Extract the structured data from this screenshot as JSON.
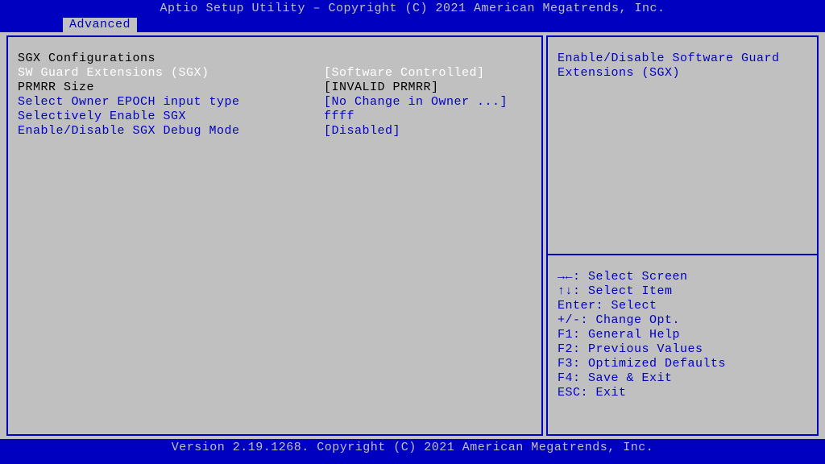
{
  "header": {
    "title": "Aptio Setup Utility – Copyright (C) 2021 American Megatrends, Inc.",
    "active_tab": "Advanced"
  },
  "main": {
    "section_title": "SGX Configurations",
    "rows": [
      {
        "label": "SW Guard Extensions (SGX)",
        "value": "[Software Controlled]",
        "style": "highlight"
      },
      {
        "label": "PRMRR Size",
        "value": "[INVALID PRMRR]",
        "style": "static"
      },
      {
        "label": "Select Owner EPOCH input type",
        "value": "[No Change in Owner ...]",
        "style": "option"
      },
      {
        "label": "Selectively Enable SGX",
        "value": "ffff",
        "style": "option"
      },
      {
        "label": "Enable/Disable SGX Debug Mode",
        "value": "[Disabled]",
        "style": "option"
      }
    ]
  },
  "help": {
    "description_line1": "Enable/Disable Software Guard",
    "description_line2": "Extensions (SGX)",
    "keys": [
      {
        "glyph": "→←",
        "text": ": Select Screen"
      },
      {
        "glyph": "↑↓",
        "text": ": Select Item"
      },
      {
        "glyph": "Enter",
        "text": ": Select"
      },
      {
        "glyph": "+/-",
        "text": ": Change Opt."
      },
      {
        "glyph": "F1",
        "text": ": General Help"
      },
      {
        "glyph": "F2",
        "text": ": Previous Values"
      },
      {
        "glyph": "F3",
        "text": ": Optimized Defaults"
      },
      {
        "glyph": "F4",
        "text": ": Save & Exit"
      },
      {
        "glyph": "ESC",
        "text": ": Exit"
      }
    ]
  },
  "footer": {
    "text": "Version 2.19.1268. Copyright (C) 2021 American Megatrends, Inc."
  }
}
